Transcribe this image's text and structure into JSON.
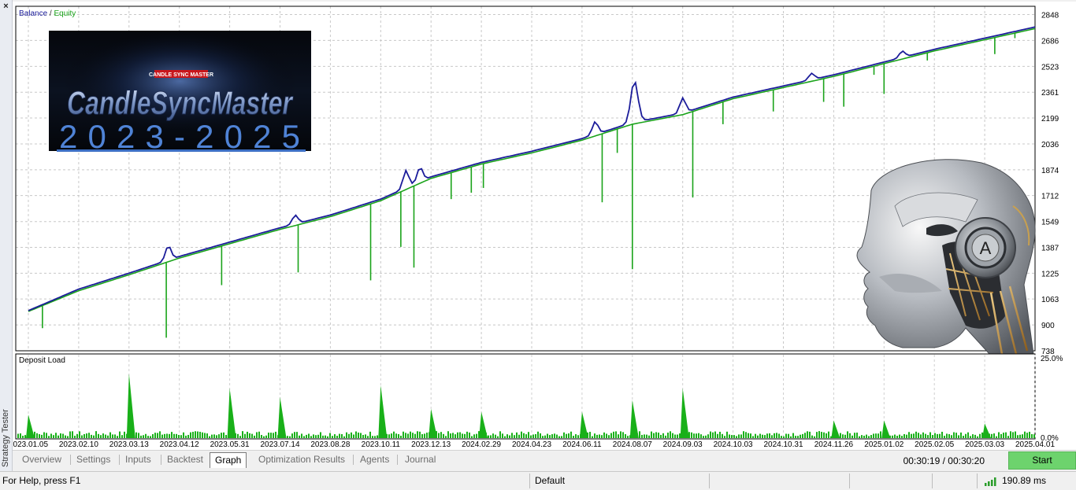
{
  "side_panel": {
    "close_glyph": "×",
    "label": "Strategy Tester"
  },
  "chart": {
    "legend": {
      "balance": "Balance",
      "separator": " / ",
      "equity": "Equity"
    },
    "balance_color": "#1b1c9a",
    "equity_color": "#1aa31a",
    "y_ticks": [
      "2848",
      "2686",
      "2523",
      "2361",
      "2199",
      "2036",
      "1874",
      "1712",
      "1549",
      "1387",
      "1225",
      "1063",
      "900",
      "738"
    ],
    "deposit_load": {
      "title": "Deposit Load",
      "max_label": "25.0%",
      "min_label": "0.0%"
    },
    "x_ticks": [
      "2023.01.05",
      "2023.02.10",
      "2023.03.13",
      "2023.04.12",
      "2023.05.31",
      "2023.07.14",
      "2023.08.28",
      "2023.10.11",
      "2023.12.13",
      "2024.02.29",
      "2024.04.23",
      "2024.06.11",
      "2024.08.07",
      "2024.09.03",
      "2024.10.03",
      "2024.10.31",
      "2024.11.26",
      "2025.01.02",
      "2025.02.05",
      "2025.03.03",
      "2025.04.01"
    ]
  },
  "banner": {
    "small_badge": "CANDLE SYNC MASTER",
    "title": "CandleSyncMaster",
    "years": "2023-2025"
  },
  "robot_image": {
    "icon": "robot-head-icon",
    "emblem_letter": "A"
  },
  "chart_data": [
    {
      "type": "line",
      "title": "",
      "series": [
        {
          "name": "Balance",
          "x": [
            "2023.01.05",
            "2023.02.10",
            "2023.03.13",
            "2023.04.12",
            "2023.05.31",
            "2023.07.14",
            "2023.08.28",
            "2023.10.11",
            "2023.12.13",
            "2024.02.29",
            "2024.04.23",
            "2024.06.11",
            "2024.08.07",
            "2024.09.03",
            "2024.10.03",
            "2024.10.31",
            "2024.11.26",
            "2025.01.02",
            "2025.02.05",
            "2025.03.03",
            "2025.04.01"
          ],
          "values": [
            990,
            1125,
            1225,
            1330,
            1420,
            1510,
            1590,
            1690,
            1830,
            1920,
            1990,
            2070,
            2170,
            2230,
            2330,
            2400,
            2470,
            2550,
            2630,
            2700,
            2770
          ]
        },
        {
          "name": "Equity",
          "x": [
            "2023.01.05",
            "2023.02.10",
            "2023.03.13",
            "2023.04.12",
            "2023.05.31",
            "2023.07.14",
            "2023.08.28",
            "2023.10.11",
            "2023.12.13",
            "2024.02.29",
            "2024.04.23",
            "2024.06.11",
            "2024.08.07",
            "2024.09.03",
            "2024.10.03",
            "2024.10.31",
            "2024.11.26",
            "2025.01.02",
            "2025.02.05",
            "2025.03.03",
            "2025.04.01"
          ],
          "values": [
            985,
            1115,
            1215,
            1320,
            1410,
            1500,
            1580,
            1680,
            1820,
            1910,
            1980,
            2060,
            2160,
            2220,
            2320,
            2390,
            2460,
            2540,
            2620,
            2690,
            2760
          ]
        }
      ],
      "ylim": [
        738,
        2900
      ],
      "grid": true,
      "legend_position": "top-left"
    },
    {
      "type": "bar",
      "title": "Deposit Load",
      "ylim": [
        0,
        25
      ],
      "units": "%",
      "peaks": [
        {
          "x": "2023.01.05",
          "value": 8
        },
        {
          "x": "2023.03.13",
          "value": 22
        },
        {
          "x": "2023.05.31",
          "value": 17
        },
        {
          "x": "2023.07.14",
          "value": 14
        },
        {
          "x": "2023.10.11",
          "value": 18
        },
        {
          "x": "2023.12.13",
          "value": 10
        },
        {
          "x": "2024.02.29",
          "value": 9
        },
        {
          "x": "2024.06.11",
          "value": 9
        },
        {
          "x": "2024.08.07",
          "value": 13
        },
        {
          "x": "2024.09.03",
          "value": 17
        },
        {
          "x": "2024.11.26",
          "value": 6
        },
        {
          "x": "2025.01.02",
          "value": 6
        },
        {
          "x": "2025.03.03",
          "value": 5
        }
      ]
    }
  ],
  "tabs": [
    {
      "label": "Overview",
      "active": false
    },
    {
      "label": "Settings",
      "active": false
    },
    {
      "label": "Inputs",
      "active": false
    },
    {
      "label": "Backtest",
      "active": false
    },
    {
      "label": "Graph",
      "active": true
    },
    {
      "label": "Optimization Results",
      "active": false
    },
    {
      "label": "Agents",
      "active": false
    },
    {
      "label": "Journal",
      "active": false
    }
  ],
  "timer": "00:30:19 / 00:30:20",
  "start_button": "Start",
  "status_bar": {
    "help": "For Help, press F1",
    "profile": "Default",
    "ping": "190.89 ms"
  }
}
